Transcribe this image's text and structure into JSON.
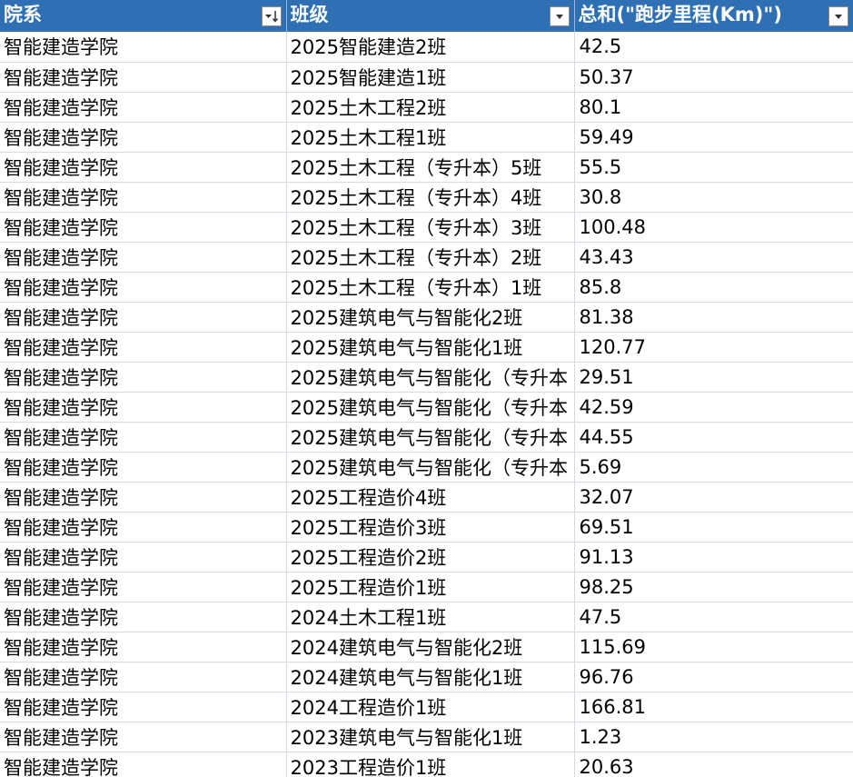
{
  "headers": {
    "col1": "院系",
    "col2": "班级",
    "col3": "总和(\"跑步里程(Km)\")"
  },
  "icons": {
    "col1_filter": "filter-sort-descending-icon",
    "col2_filter": "filter-dropdown-icon",
    "col3_filter": "filter-dropdown-icon"
  },
  "colors": {
    "header_bg": "#2f6fb4",
    "header_text": "#ffffff",
    "grid": "#d6dbe3"
  },
  "rows": [
    {
      "dept": "智能建造学院",
      "class": "2025智能建造2班",
      "km": "42.5"
    },
    {
      "dept": "智能建造学院",
      "class": "2025智能建造1班",
      "km": "50.37"
    },
    {
      "dept": "智能建造学院",
      "class": "2025土木工程2班",
      "km": "80.1"
    },
    {
      "dept": "智能建造学院",
      "class": "2025土木工程1班",
      "km": "59.49"
    },
    {
      "dept": "智能建造学院",
      "class": "2025土木工程（专升本）5班",
      "km": "55.5"
    },
    {
      "dept": "智能建造学院",
      "class": "2025土木工程（专升本）4班",
      "km": "30.8"
    },
    {
      "dept": "智能建造学院",
      "class": "2025土木工程（专升本）3班",
      "km": "100.48"
    },
    {
      "dept": "智能建造学院",
      "class": "2025土木工程（专升本）2班",
      "km": "43.43"
    },
    {
      "dept": "智能建造学院",
      "class": "2025土木工程（专升本）1班",
      "km": "85.8"
    },
    {
      "dept": "智能建造学院",
      "class": "2025建筑电气与智能化2班",
      "km": "81.38"
    },
    {
      "dept": "智能建造学院",
      "class": "2025建筑电气与智能化1班",
      "km": "120.77"
    },
    {
      "dept": "智能建造学院",
      "class": "2025建筑电气与智能化（专升本",
      "km": "29.51"
    },
    {
      "dept": "智能建造学院",
      "class": "2025建筑电气与智能化（专升本",
      "km": "42.59"
    },
    {
      "dept": "智能建造学院",
      "class": "2025建筑电气与智能化（专升本",
      "km": "44.55"
    },
    {
      "dept": "智能建造学院",
      "class": "2025建筑电气与智能化（专升本",
      "km": "5.69"
    },
    {
      "dept": "智能建造学院",
      "class": "2025工程造价4班",
      "km": "32.07"
    },
    {
      "dept": "智能建造学院",
      "class": "2025工程造价3班",
      "km": "69.51"
    },
    {
      "dept": "智能建造学院",
      "class": "2025工程造价2班",
      "km": "91.13"
    },
    {
      "dept": "智能建造学院",
      "class": "2025工程造价1班",
      "km": "98.25"
    },
    {
      "dept": "智能建造学院",
      "class": "2024土木工程1班",
      "km": "47.5"
    },
    {
      "dept": "智能建造学院",
      "class": "2024建筑电气与智能化2班",
      "km": "115.69"
    },
    {
      "dept": "智能建造学院",
      "class": "2024建筑电气与智能化1班",
      "km": "96.76"
    },
    {
      "dept": "智能建造学院",
      "class": "2024工程造价1班",
      "km": "166.81"
    },
    {
      "dept": "智能建造学院",
      "class": "2023建筑电气与智能化1班",
      "km": "1.23"
    },
    {
      "dept": "智能建造学院",
      "class": "2023工程造价1班",
      "km": "20.63"
    }
  ]
}
